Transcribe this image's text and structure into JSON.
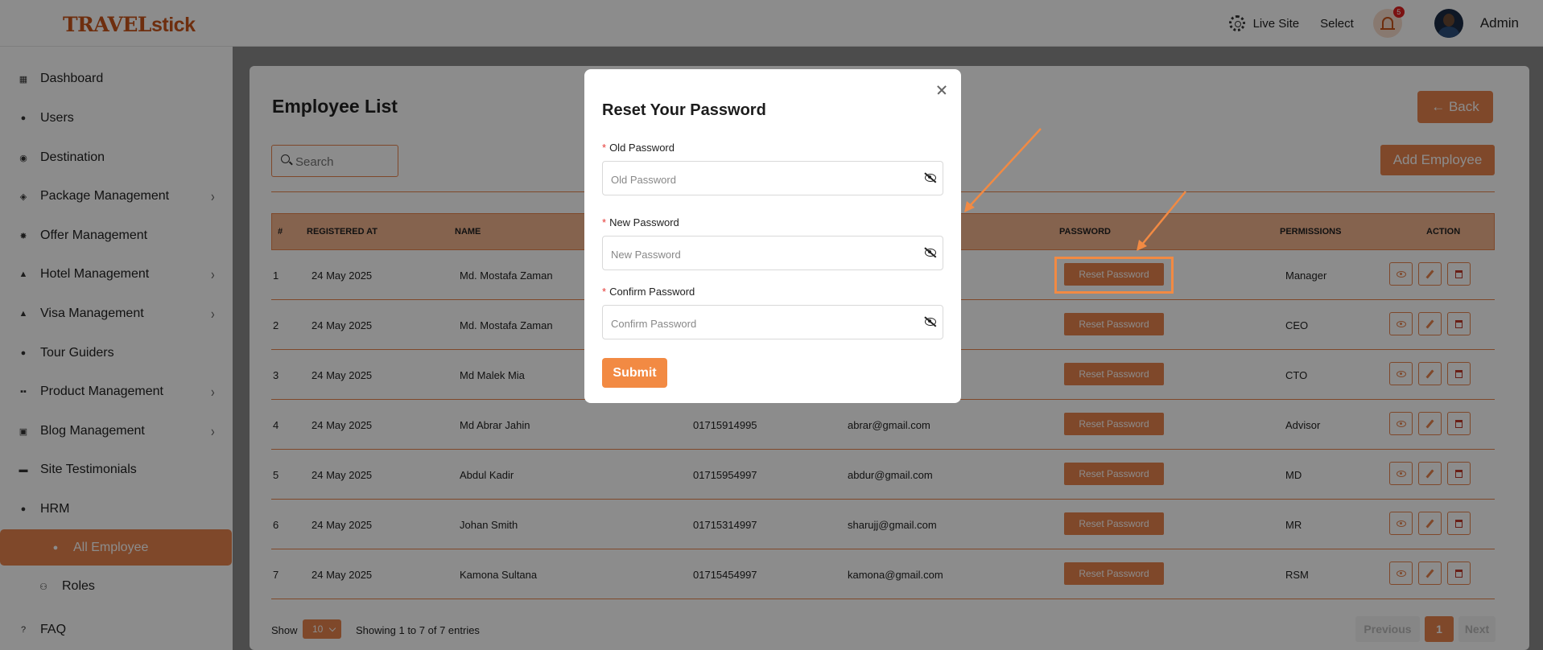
{
  "header": {
    "logo_prefix": "TRAVEL",
    "logo_suffix": "stick",
    "live_site": "Live Site",
    "select": "Select",
    "notification_count": "5",
    "user_name": "Admin"
  },
  "sidebar": {
    "items": [
      {
        "label": "Dashboard",
        "icon": "dashboard-icon"
      },
      {
        "label": "Users",
        "icon": "users-icon"
      },
      {
        "label": "Destination",
        "icon": "location-icon"
      },
      {
        "label": "Package Management",
        "icon": "package-icon"
      },
      {
        "label": "Offer Management",
        "icon": "offer-icon"
      },
      {
        "label": "Hotel Management",
        "icon": "hotel-icon"
      },
      {
        "label": "Visa Management",
        "icon": "visa-icon"
      },
      {
        "label": "Tour Guiders",
        "icon": "guide-icon"
      },
      {
        "label": "Product Management",
        "icon": "product-icon"
      },
      {
        "label": "Blog Management",
        "icon": "blog-icon"
      },
      {
        "label": "Site Testimonials",
        "icon": "testimonial-icon"
      },
      {
        "label": "HRM",
        "icon": "hrm-icon"
      },
      {
        "label": "All Employee",
        "icon": "employees-icon"
      },
      {
        "label": "Roles",
        "icon": "roles-icon"
      },
      {
        "label": "FAQ",
        "icon": "faq-icon"
      }
    ]
  },
  "page": {
    "title": "Employee List",
    "back_label": "← Back",
    "add_label": "Add Employee",
    "search_placeholder": "Search"
  },
  "table": {
    "columns": [
      "#",
      "REGISTERED AT",
      "NAME",
      "PASSWORD",
      "PERMISSIONS",
      "ACTION"
    ],
    "reset_label": "Reset Password",
    "rows": [
      {
        "id": "1",
        "date": "24 May 2025",
        "name": "Md. Mostafa Zaman",
        "phone": "",
        "email": "",
        "permission": "Manager"
      },
      {
        "id": "2",
        "date": "24 May 2025",
        "name": "Md. Mostafa Zaman",
        "phone": "",
        "email": "",
        "permission": "CEO"
      },
      {
        "id": "3",
        "date": "24 May 2025",
        "name": "Md Malek Mia",
        "phone": "",
        "email": "",
        "permission": "CTO"
      },
      {
        "id": "4",
        "date": "24 May 2025",
        "name": "Md Abrar Jahin",
        "phone": "01715914995",
        "email": "abrar@gmail.com",
        "permission": "Advisor"
      },
      {
        "id": "5",
        "date": "24 May 2025",
        "name": "Abdul Kadir",
        "phone": "01715954997",
        "email": "abdur@gmail.com",
        "permission": "MD"
      },
      {
        "id": "6",
        "date": "24 May 2025",
        "name": "Johan Smith",
        "phone": "01715314997",
        "email": "sharujj@gmail.com",
        "permission": "MR"
      },
      {
        "id": "7",
        "date": "24 May 2025",
        "name": "Kamona Sultana",
        "phone": "01715454997",
        "email": "kamona@gmail.com",
        "permission": "RSM"
      }
    ]
  },
  "footer": {
    "show_label": "Show",
    "page_size": "10",
    "info": "Showing 1 to 7 of 7 entries",
    "previous": "Previous",
    "current_page": "1",
    "next": "Next"
  },
  "modal": {
    "title": "Reset Your Password",
    "fields": [
      {
        "label": "Old Password",
        "placeholder": "Old Password"
      },
      {
        "label": "New Password",
        "placeholder": "New Password"
      },
      {
        "label": "Confirm Password",
        "placeholder": "Confirm Password"
      }
    ],
    "required_mark": "*",
    "submit_label": "Submit"
  },
  "colors": {
    "accent": "#e8834d",
    "annotation": "#f28a43"
  }
}
